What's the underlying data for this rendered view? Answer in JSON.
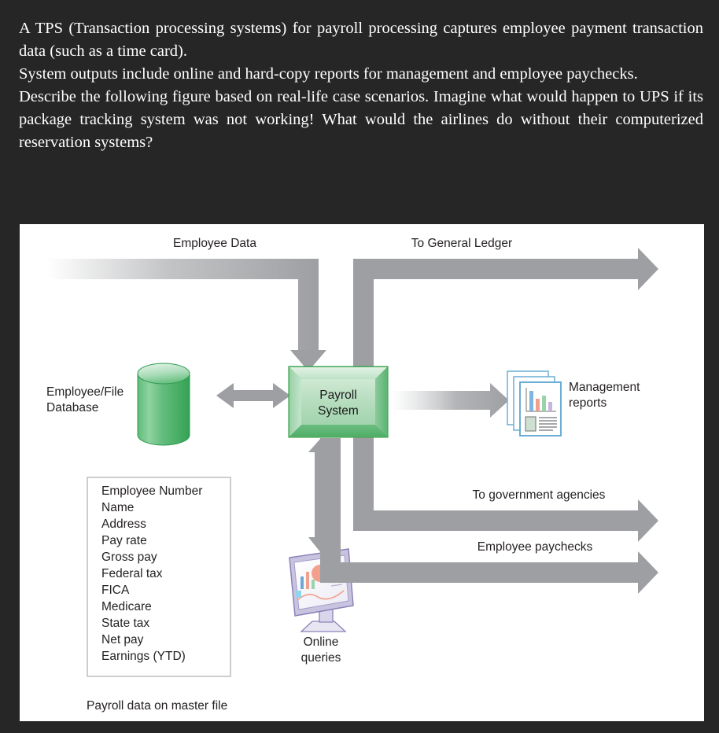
{
  "prose": {
    "paragraphs": [
      "A TPS (Transaction processing systems) for payroll processing captures employee payment transaction data (such as a time card).",
      "System outputs include online and hard-copy reports for management and employee paychecks.",
      "Describe the following figure based on real-life case scenarios. Imagine what would happen to UPS if its package tracking system was not working! What would the airlines do without their computerized reservation systems?"
    ]
  },
  "figure": {
    "flows": {
      "employee_data": "Employee Data",
      "to_general_ledger": "To General Ledger",
      "to_government_agencies": "To government agencies",
      "employee_paychecks": "Employee paychecks"
    },
    "nodes": {
      "database_label_line1": "Employee/File",
      "database_label_line2": "Database",
      "system_label_line1": "Payroll",
      "system_label_line2": "System",
      "reports_label_line1": "Management",
      "reports_label_line2": "reports",
      "queries_label_line1": "Online",
      "queries_label_line2": "queries"
    },
    "master_file": {
      "caption": "Payroll data on master file",
      "fields": [
        "Employee Number",
        "Name",
        "Address",
        "Pay rate",
        "Gross pay",
        "Federal tax",
        "FICA",
        "Medicare",
        "State tax",
        "Net pay",
        "Earnings (YTD)"
      ]
    },
    "colors": {
      "page_background": "#262626",
      "panel_background": "#ffffff",
      "arrow_gray": "#9d9fa2",
      "arrow_gray_dark": "#8a8c8f",
      "system_green": "#8fcf9e",
      "system_green_border": "#3ea34f",
      "database_green": "#4cb86a",
      "report_blue": "#74b4d8",
      "monitor_purple": "#8a83b8",
      "text_dark": "#231f20",
      "prose_text": "#ffffff"
    }
  }
}
